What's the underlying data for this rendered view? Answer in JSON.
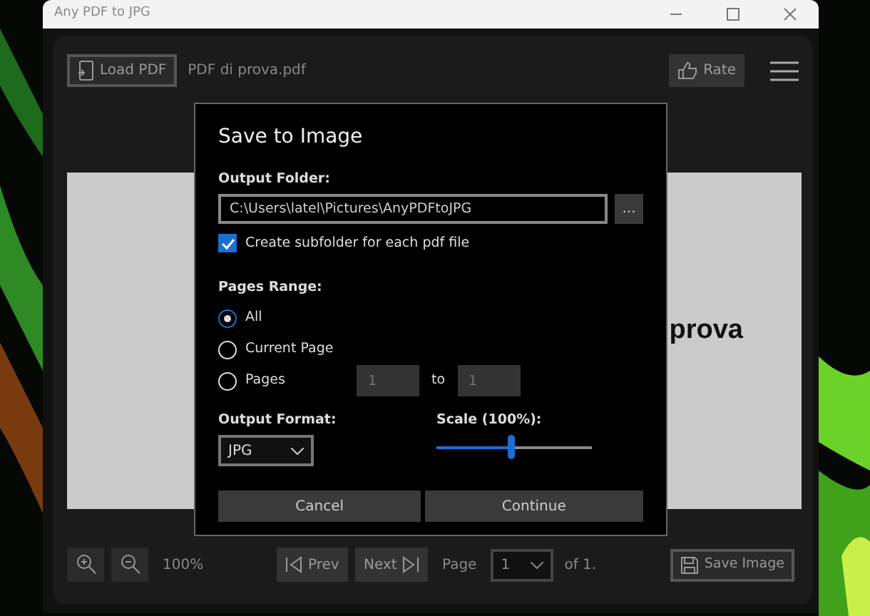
{
  "window": {
    "title": "Any PDF to JPG"
  },
  "toolbar": {
    "load_button": "Load PDF",
    "file_name": "PDF di prova.pdf",
    "rate_button": "Rate"
  },
  "document": {
    "visible_text": "prova"
  },
  "dialog": {
    "title": "Save to Image",
    "output_folder_label": "Output Folder:",
    "output_folder": "C:\\Users\\latel\\Pictures\\AnyPDFtoJPG",
    "browse_button": "...",
    "subfolder": {
      "label": "Create subfolder for each pdf file",
      "checked": true
    },
    "pages_range_label": "Pages Range:",
    "ranges": [
      {
        "label": "All",
        "selected": true
      },
      {
        "label": "Current Page",
        "selected": false
      },
      {
        "label": "Pages",
        "selected": false
      }
    ],
    "page_from": "1",
    "page_to_label": "to",
    "page_to": "1",
    "format_label": "Output Format:",
    "format": "JPG",
    "scale_label": "Scale (100%):",
    "scale": {
      "level": 0.48
    },
    "buttons": [
      "Cancel",
      "Continue"
    ]
  },
  "bottom_bar": {
    "zoom": "100%",
    "prev": "Prev",
    "next": "Next",
    "page_label": "Page",
    "page": "1",
    "of": "of 1.",
    "save_button": "Save Image"
  }
}
